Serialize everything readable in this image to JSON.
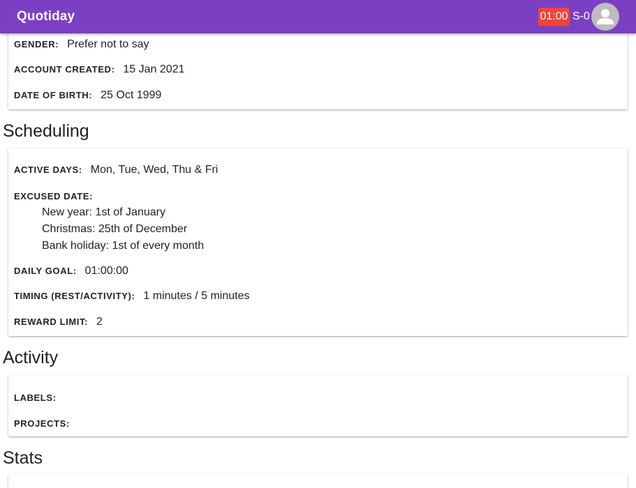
{
  "appbar": {
    "title": "Quotiday",
    "timer": "01:00",
    "streak": "S-0",
    "colors": {
      "bar": "#7b3fc4",
      "timer_badge": "#f44336"
    },
    "avatar_icon": "person-icon"
  },
  "profile": {
    "gender_label": "GENDER:",
    "gender_value": "Prefer not to say",
    "created_label": "ACCOUNT CREATED:",
    "created_value": "15 Jan 2021",
    "dob_label": "DATE OF BIRTH:",
    "dob_value": "25 Oct 1999"
  },
  "scheduling": {
    "title": "Scheduling",
    "active_days_label": "ACTIVE DAYS:",
    "active_days_value": "Mon, Tue, Wed, Thu & Fri",
    "excused_label": "EXCUSED DATE:",
    "excused_dates": [
      "New year: 1st of January",
      "Christmas: 25th of December",
      "Bank holiday: 1st of every month"
    ],
    "daily_goal_label": "DAILY GOAL:",
    "daily_goal_value": "01:00:00",
    "timing_label": "TIMING (REST/ACTIVITY):",
    "timing_value": "1 minutes / 5 minutes",
    "reward_label": "REWARD LIMIT:",
    "reward_value": "2"
  },
  "activity": {
    "title": "Activity",
    "labels_label": "LABELS:",
    "projects_label": "PROJECTS:"
  },
  "stats": {
    "title": "Stats"
  }
}
